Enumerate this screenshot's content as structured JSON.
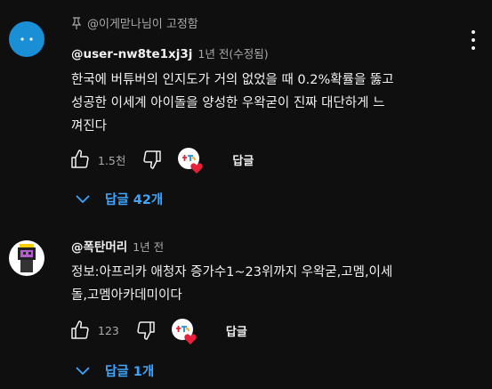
{
  "comments": [
    {
      "pinned_label": "@이게맏나님이 고정함",
      "author": "@user-nw8te1xj3j",
      "time": "1년 전(수정됨)",
      "text_lines": [
        "한국에 버튜버의 인지도가 거의 없었을 때 0.2%확률을 뚫고",
        "성공한 이세계 아이돌을 양성한 우왁굳이 진짜 대단하게 느",
        "껴진다"
      ],
      "like_count": "1.5천",
      "reply_label": "답글",
      "replies_toggle": "답글 42개",
      "avatar_color": "#1a8fd6"
    },
    {
      "author": "@폭탄머리",
      "time": "1년 전",
      "text_lines": [
        "정보:아프리카 애청자 증가수1~23위까지 우왁굳,고멤,이세",
        "돌,고멤아카데미이다"
      ],
      "like_count": "123",
      "reply_label": "답글",
      "replies_toggle": "답글 1개"
    }
  ],
  "colors": {
    "background": "#0f0f0f",
    "text": "#f1f1f1",
    "muted": "#aaaaaa",
    "link": "#3ea6ff",
    "heart": "#e8213a"
  },
  "icons": [
    "pin-icon",
    "thumb-up-icon",
    "thumb-down-icon",
    "creator-heart-icon",
    "more-vert-icon",
    "chevron-down-icon"
  ]
}
